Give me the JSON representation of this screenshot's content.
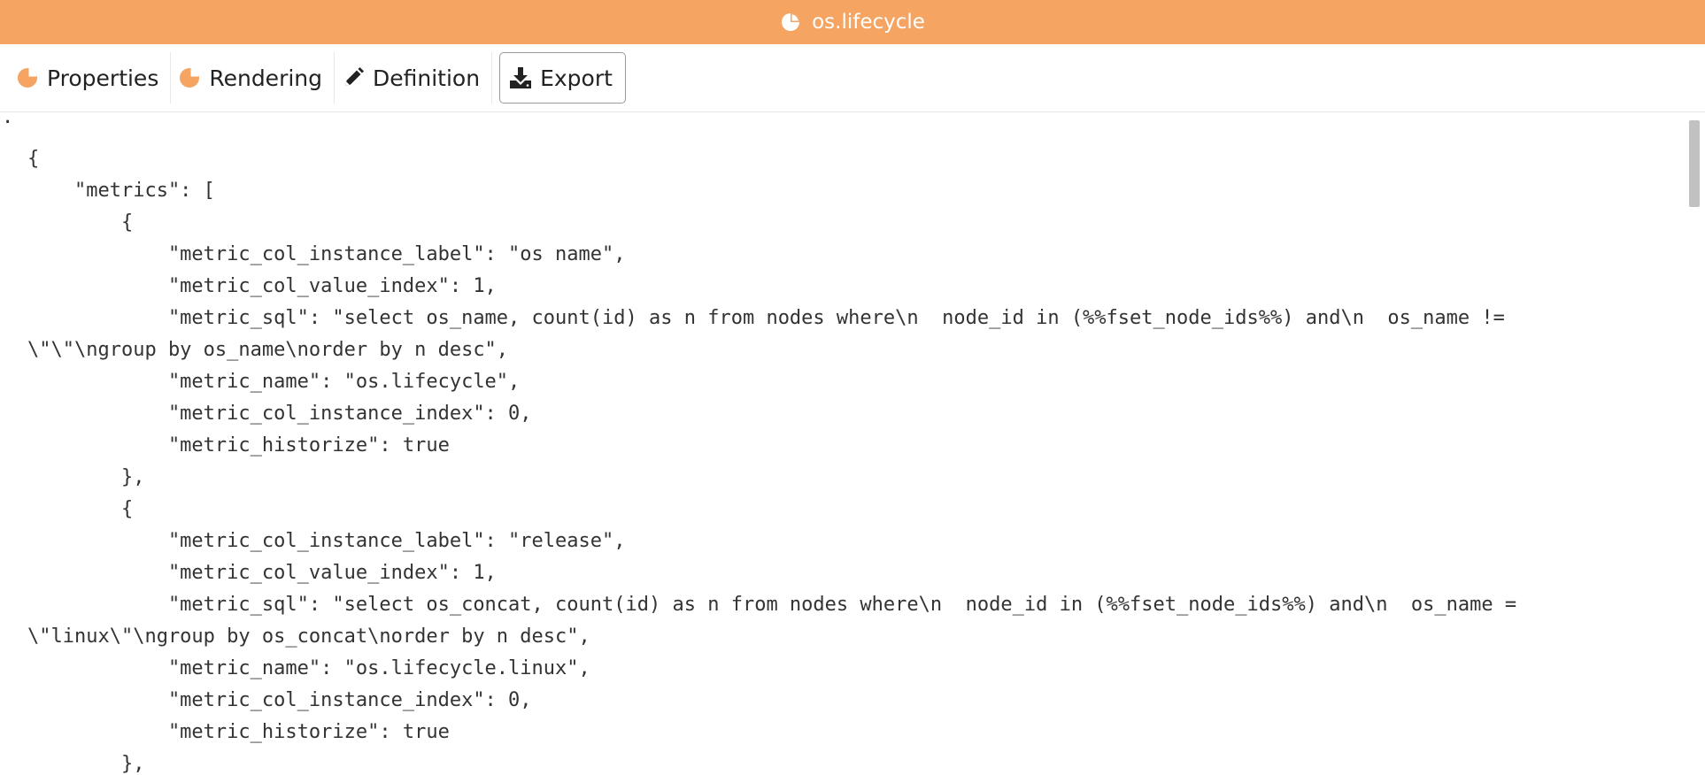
{
  "window": {
    "title": "os.lifecycle",
    "title_icon": "pie-chart-icon"
  },
  "colors": {
    "titlebar": "#f5a462",
    "accent_icon": "#f5a462"
  },
  "tabs": [
    {
      "label": "Properties",
      "icon": "pie-chart-icon"
    },
    {
      "label": "Rendering",
      "icon": "pie-chart-icon"
    },
    {
      "label": "Definition",
      "icon": "pencil-icon"
    },
    {
      "label": "Export",
      "icon": "download-icon",
      "active": true
    }
  ],
  "export": {
    "marker": ".",
    "lines": [
      "{",
      "    \"metrics\": [",
      "        {",
      "            \"metric_col_instance_label\": \"os name\",",
      "            \"metric_col_value_index\": 1,",
      "            \"metric_sql\": \"select os_name, count(id) as n from nodes where\\n  node_id in (%%fset_node_ids%%) and\\n  os_name !=",
      "\\\"\\\"\\ngroup by os_name\\norder by n desc\",",
      "            \"metric_name\": \"os.lifecycle\",",
      "            \"metric_col_instance_index\": 0,",
      "            \"metric_historize\": true",
      "        },",
      "        {",
      "            \"metric_col_instance_label\": \"release\",",
      "            \"metric_col_value_index\": 1,",
      "            \"metric_sql\": \"select os_concat, count(id) as n from nodes where\\n  node_id in (%%fset_node_ids%%) and\\n  os_name =",
      "\\\"linux\\\"\\ngroup by os_concat\\norder by n desc\",",
      "            \"metric_name\": \"os.lifecycle.linux\",",
      "            \"metric_col_instance_index\": 0,",
      "            \"metric_historize\": true",
      "        },"
    ]
  }
}
